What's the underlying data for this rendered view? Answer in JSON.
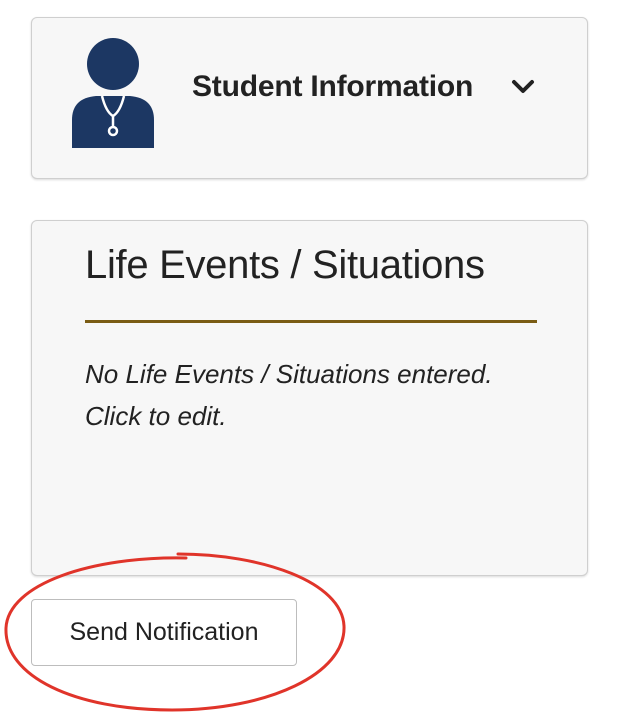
{
  "student_card": {
    "title": "Student Information",
    "avatar_icon": "student-avatar-icon",
    "chevron_icon": "chevron-down-icon"
  },
  "life_events": {
    "title": "Life Events / Situations",
    "empty_message": "No Life Events / Situations entered. Click to edit.",
    "divider_color": "#7a5c14"
  },
  "actions": {
    "send_notification_label": "Send Notification"
  },
  "colors": {
    "avatar": "#1c3763",
    "annotation": "#e0342a",
    "card_background": "#f7f7f7"
  }
}
